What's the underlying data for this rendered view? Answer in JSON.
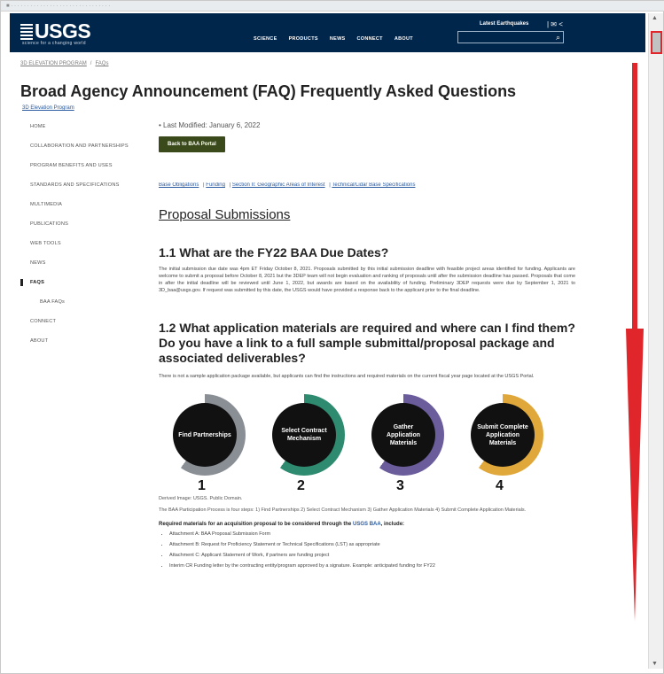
{
  "browser": {
    "topstrip_text": "■ · · · · · · · · · · · · · · · · · · · · · · · · · · · · · · ·"
  },
  "header": {
    "logo": "USGS",
    "tagline": "science for a changing world",
    "nav": [
      "SCIENCE",
      "PRODUCTS",
      "NEWS",
      "CONNECT",
      "ABOUT"
    ],
    "latest": "Latest Earthquakes",
    "social": "| ✉ <",
    "search_placeholder": "",
    "brand_color": "#00264c"
  },
  "breadcrumb": [
    "3D ELEVATION PROGRAM",
    "FAQs"
  ],
  "title": "Broad Agency Announcement (FAQ) Frequently Asked Questions",
  "program_link": "3D Elevation Program",
  "sidebar": {
    "items": [
      {
        "label": "HOME"
      },
      {
        "label": "COLLABORATION AND PARTNERSHIPS"
      },
      {
        "label": "PROGRAM BENEFITS AND USES"
      },
      {
        "label": "STANDARDS AND SPECIFICATIONS"
      },
      {
        "label": "MULTIMEDIA"
      },
      {
        "label": "PUBLICATIONS"
      },
      {
        "label": "WEB TOOLS"
      },
      {
        "label": "NEWS"
      },
      {
        "label": "FAQS"
      },
      {
        "label": "BAA FAQs"
      },
      {
        "label": "CONNECT"
      },
      {
        "label": "ABOUT"
      }
    ]
  },
  "main": {
    "last_modified": "• Last Modified: January 6, 2022",
    "back_button": "Back to BAA Portal",
    "toc": [
      "Base Obligations",
      "Funding",
      "Section II: Geographic Areas of Interest",
      "Technical/Lidar Base Specifications"
    ],
    "section_heading": "Proposal Submissions",
    "q1": "1.1  What are the FY22 BAA Due Dates?",
    "p1": "The initial submission due date was 4pm ET Friday October 8, 2021. Proposals submitted by this initial submission deadline with feasible project areas identified for funding. Applicants are welcome to submit a proposal before October 8, 2021 but the 3DEP team will not begin evaluation and ranking of proposals until after the submission deadline has passed. Proposals that come in after the initial deadline will be reviewed until June 1, 2022, but awards are based on the availability of funding. Preliminary 3DEP requests were due by September 1, 2021 to 3D_baa@usgs.gov. If request was submitted by this date, the USGS would have provided a response back to the applicant prior to the final deadline.",
    "q2": "1.2  What application materials are required and where can I find them? Do you have a link to a full sample submittal/proposal package and associated deliverables?",
    "p2": "There is not a sample application package available, but applicants can find the instructions and required materials on the current fiscal year page located at the USGS Portal.",
    "steps": [
      {
        "label": "Find Partnerships",
        "num": "1",
        "ring": "#8a8f96"
      },
      {
        "label": "Select Contract Mechanism",
        "num": "2",
        "ring": "#2e8b6f"
      },
      {
        "label": "Gather Application Materials",
        "num": "3",
        "ring": "#6b5c9c"
      },
      {
        "label": "Submit Complete Application Materials",
        "num": "4",
        "ring": "#e0a83a"
      }
    ],
    "caption_credit": "Derived Image: USGS. Public Domain.",
    "caption": "The BAA Participation Process is four steps: 1) Find Partnerships 2) Select Contract Mechanism 3) Gather Application Materials 4) Submit Complete Application Materials.",
    "req_intro": "Required materials for an acquisition proposal to be considered through the",
    "req_link": "USGS BAA",
    "req_tail": ", include:",
    "req_items": [
      "Attachment A: BAA Proposal Submission Form",
      "Attachment B: Request for Proficiency Statement or Technical Specifications (LST) as appropriate",
      "Attachment C: Applicant Statement of Work, if partners are funding project",
      "Interim CR Funding letter by the contracting entity/program approved by a signature. Example: anticipated funding for FY22"
    ]
  }
}
